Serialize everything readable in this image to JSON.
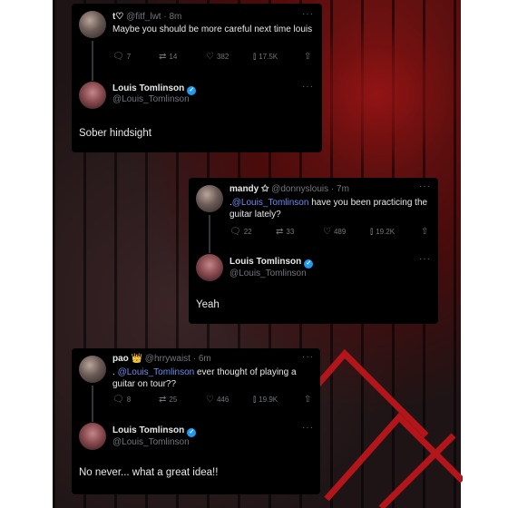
{
  "tweets": [
    {
      "author": {
        "name": "t♡",
        "handle": "@fitf_lwt",
        "time": "8m"
      },
      "text": "Maybe you should be more careful next time louis",
      "stats": {
        "replies": "7",
        "retweets": "14",
        "likes": "382",
        "views": "17.5K"
      },
      "reply": {
        "name": "Louis Tomlinson",
        "handle": "@Louis_Tomlinson",
        "text": "Sober hindsight"
      }
    },
    {
      "author": {
        "name": "mandy ✩",
        "handle": "@donnyslouis",
        "time": "7m"
      },
      "text_pre": ".",
      "mention": "@Louis_Tomlinson",
      "text_post": " have you been practicing the guitar lately?",
      "stats": {
        "replies": "22",
        "retweets": "33",
        "likes": "489",
        "views": "19.2K"
      },
      "reply": {
        "name": "Louis Tomlinson",
        "handle": "@Louis_Tomlinson",
        "text": "Yeah"
      }
    },
    {
      "author": {
        "name": "pao 👑",
        "handle": "@hrrywaist",
        "time": "6m"
      },
      "text_pre": ". ",
      "mention": "@Louis_Tomlinson",
      "text_post": " ever thought of playing a guitar on tour??",
      "stats": {
        "replies": "8",
        "retweets": "25",
        "likes": "446",
        "views": "19.9K"
      },
      "reply": {
        "name": "Louis Tomlinson",
        "handle": "@Louis_Tomlinson",
        "text": "No never... what a great idea!!"
      }
    }
  ],
  "icons": {
    "reply": "speech-bubble-icon",
    "retweet": "retweet-icon",
    "like": "heart-icon",
    "views": "bar-chart-icon",
    "share": "share-icon",
    "verified": "verified-check-icon",
    "more": "more-dots-icon"
  },
  "colors": {
    "mention": "#6a8ef2",
    "verified": "#1d9bf0",
    "card": "#000000"
  }
}
